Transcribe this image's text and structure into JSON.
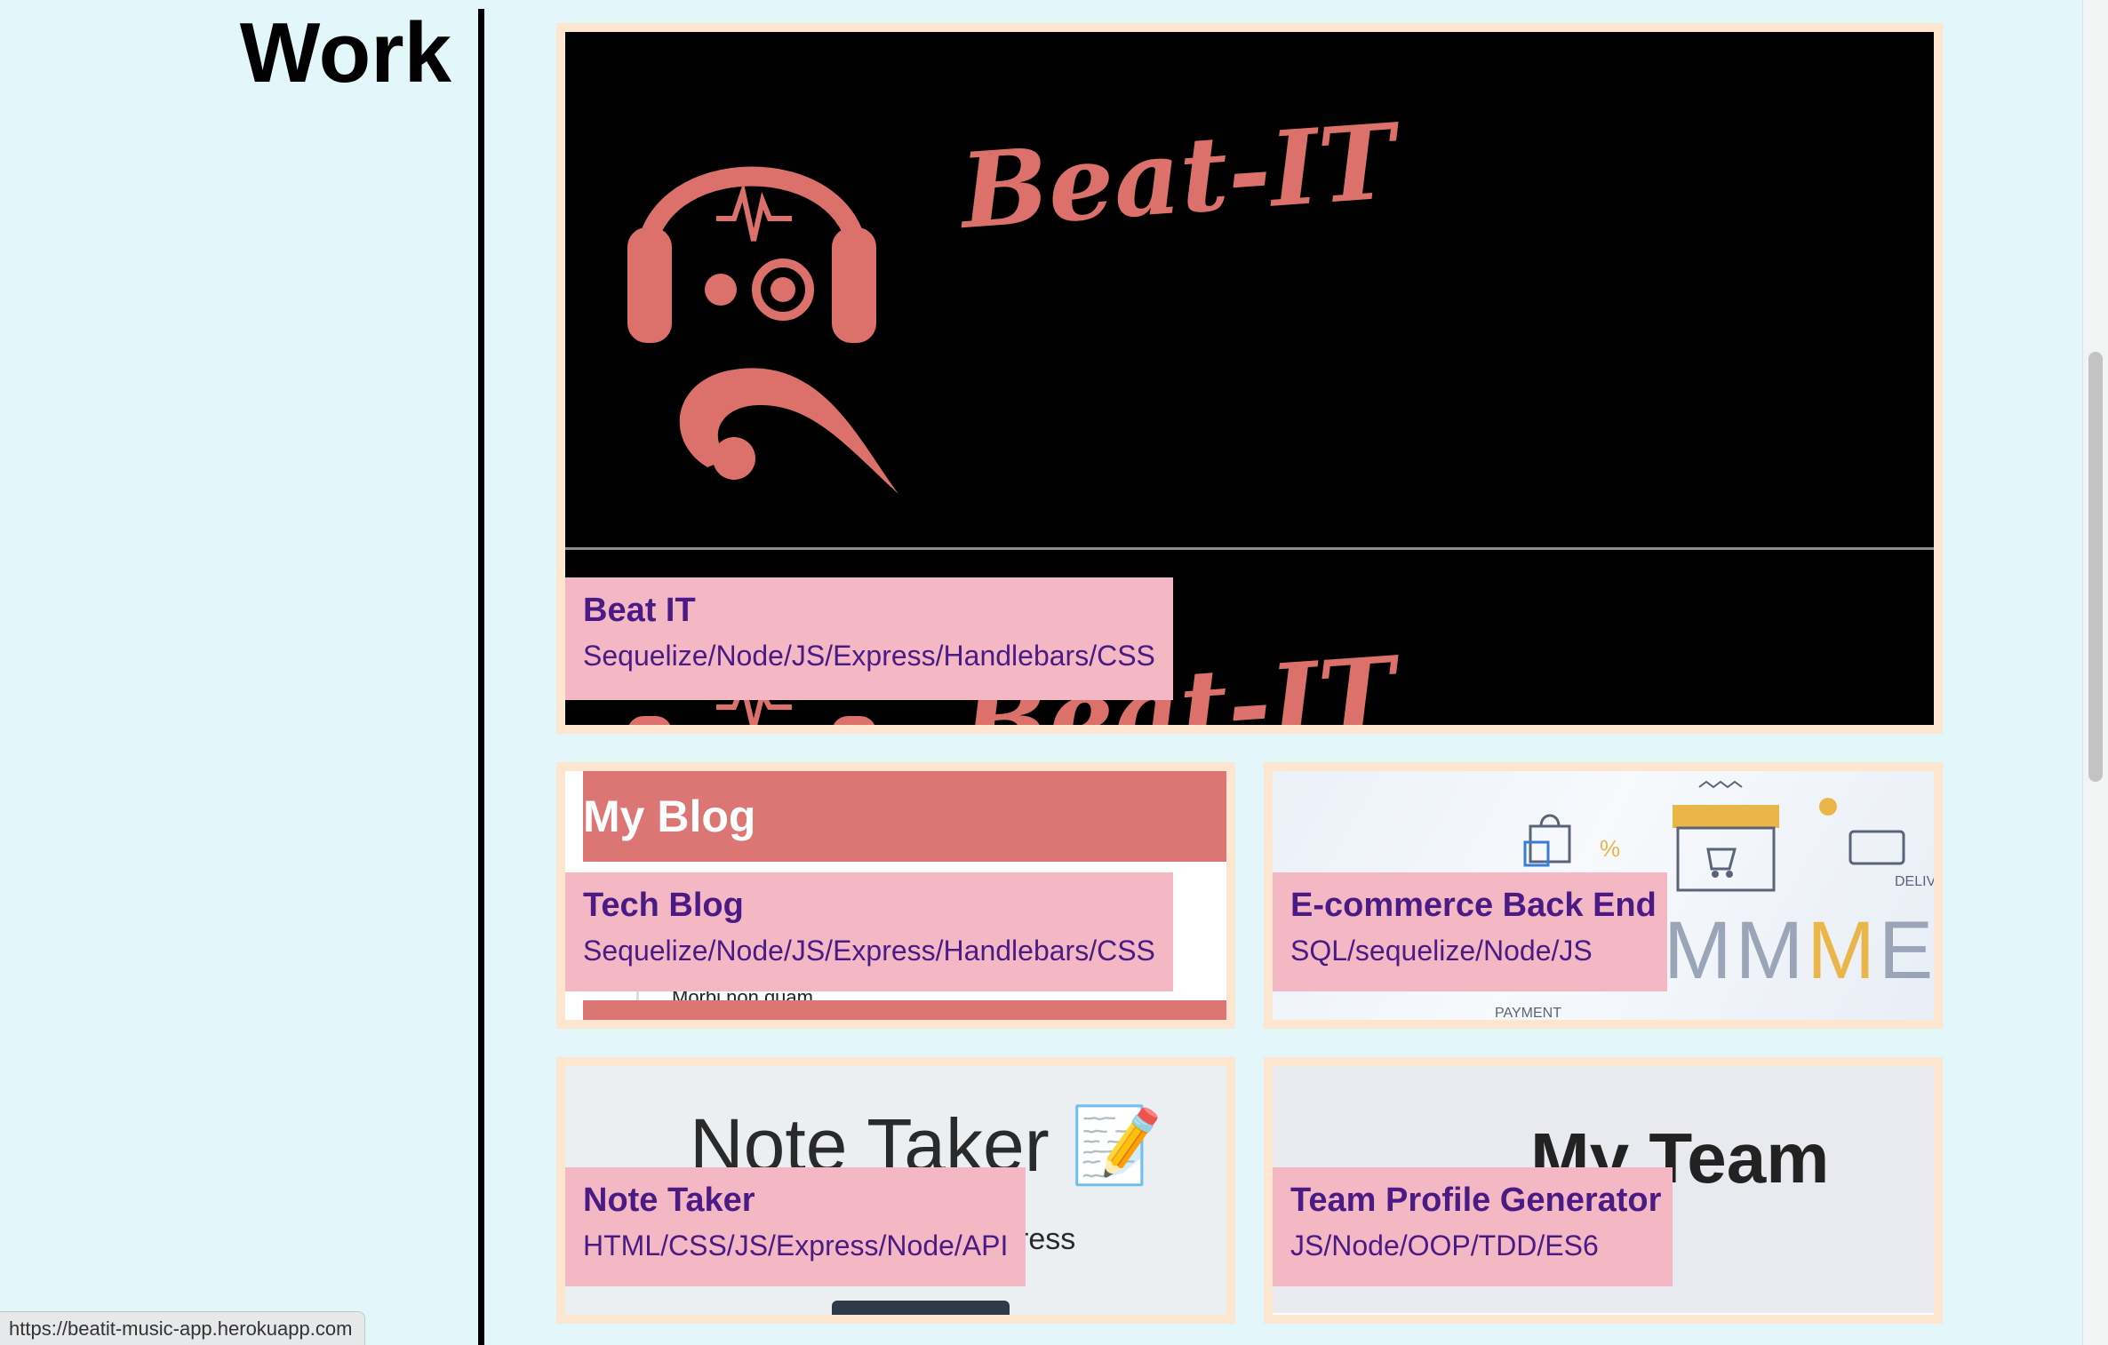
{
  "section": {
    "title": "Work"
  },
  "projects": [
    {
      "title": "Beat IT",
      "tech": "Sequelize/Node/JS/Express/Handlebars/CSS",
      "preview": {
        "logo_text": "Beat-IT",
        "logo_text_reflection": "Beat-IT"
      }
    },
    {
      "title": "Tech Blog",
      "tech": "Sequelize/Node/JS/Express/Handlebars/CSS",
      "preview": {
        "header_text": "My Blog",
        "snippet": "Morbi non quam"
      }
    },
    {
      "title": "E-commerce Back End",
      "tech": "SQL/sequelize/Node/JS",
      "preview": {
        "word_left": "MM",
        "word_accent": "M",
        "word_right": "ER",
        "label_delivery": "DELIVE",
        "label_payment": "PAYMENT",
        "label_percent": "%"
      }
    },
    {
      "title": "Note Taker",
      "tech": "HTML/CSS/JS/Express/Node/API",
      "preview": {
        "heading": "Note Taker 📝",
        "tail_text": "ress"
      }
    },
    {
      "title": "Team Profile Generator",
      "tech": "JS/Node/OOP/TDD/ES6",
      "preview": {
        "heading": "My Team"
      }
    }
  ],
  "status_bar": {
    "url": "https://beatit-music-app.herokuapp.com"
  },
  "colors": {
    "page_background": "#e3f7fa",
    "card_border": "#fde6cf",
    "caption_background": "#f4b8c4",
    "caption_text": "#4a1a85",
    "beat_it_accent": "#dc716c"
  }
}
